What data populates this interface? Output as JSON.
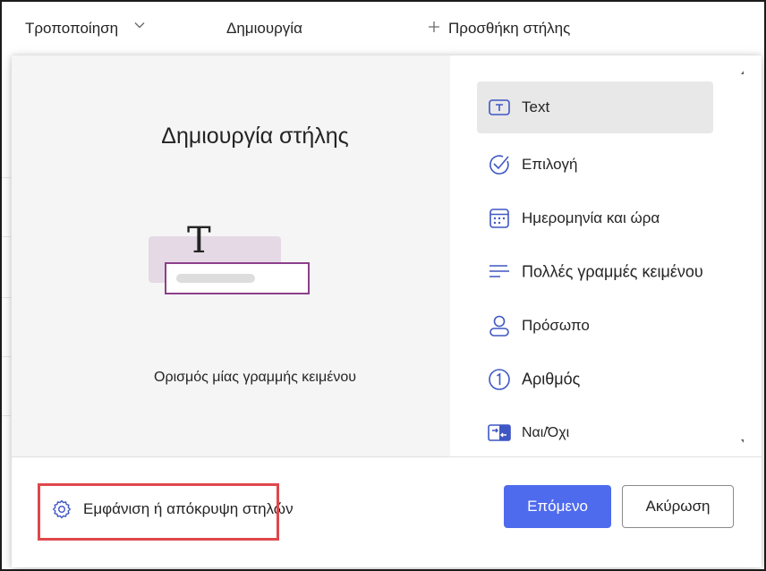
{
  "list_header": {
    "columns": [
      {
        "label": "Τροποποίηση"
      },
      {
        "label": "Δημιουργία"
      },
      {
        "label": "Προσθήκη στήλης",
        "icon": "plus-icon"
      }
    ]
  },
  "dialog": {
    "preview": {
      "title": "Δημιουργία στήλης",
      "description": "Ορισμός μίας γραμμής κειμένου",
      "illustration_glyph": "T"
    },
    "column_types": [
      {
        "label": "Text",
        "icon": "text-field-icon",
        "selected": true
      },
      {
        "label": "Επιλογή",
        "icon": "choice-check-icon",
        "selected": false
      },
      {
        "label": "Ημερομηνία και ώρα",
        "icon": "calendar-icon",
        "selected": false
      },
      {
        "label": "Πολλές γραμμές κειμένου",
        "icon": "multiline-text-icon",
        "selected": false
      },
      {
        "label": "Πρόσωπο",
        "icon": "person-icon",
        "selected": false
      },
      {
        "label": "Αριθμός",
        "icon": "number-icon",
        "selected": false
      },
      {
        "label": "Ναι/Όχι",
        "icon": "yes-no-icon",
        "selected": false
      }
    ],
    "footer": {
      "show_hide_label": "Εμφάνιση ή απόκρυψη στηλών",
      "next_label": "Επόμενο",
      "cancel_label": "Ακύρωση"
    }
  },
  "colors": {
    "primary": "#4f6bed",
    "highlight_border": "#e0474c",
    "illustration_accent": "#8c3f8a",
    "selected_item_bg": "#e8e8e8"
  }
}
